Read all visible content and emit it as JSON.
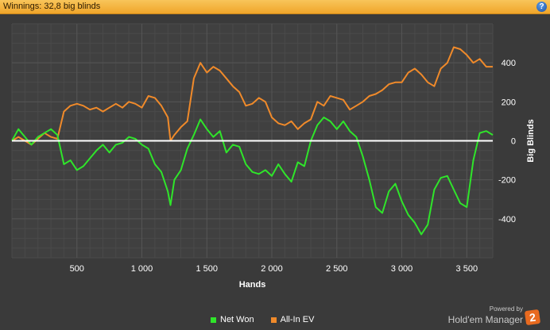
{
  "header": {
    "title": "Winnings:  32,8 big blinds",
    "help_icon": "?"
  },
  "colors": {
    "net_won": "#2fe52a",
    "all_in_ev": "#f08a2a",
    "zero_line": "#ffffff",
    "plot_bg": "#404040",
    "grid": "#555555"
  },
  "chart_data": {
    "type": "line",
    "xlabel": "Hands",
    "ylabel": "Big Blinds",
    "xlim": [
      0,
      3700
    ],
    "ylim": [
      -600,
      600
    ],
    "x_ticks": [
      500,
      1000,
      1500,
      2000,
      2500,
      3000,
      3500
    ],
    "x_tick_labels": [
      "500",
      "1 000",
      "1 500",
      "2 000",
      "2 500",
      "3 000",
      "3 500"
    ],
    "y_ticks": [
      400,
      200,
      0,
      -200,
      -400
    ],
    "y_tick_labels": [
      "400",
      "200",
      "0",
      "-200",
      "-400"
    ],
    "grid": true,
    "y_axis_position": "right",
    "series": [
      {
        "name": "Net Won",
        "x": [
          0,
          50,
          100,
          150,
          200,
          250,
          300,
          350,
          400,
          450,
          500,
          550,
          600,
          650,
          700,
          750,
          800,
          850,
          900,
          950,
          1000,
          1050,
          1100,
          1150,
          1200,
          1220,
          1250,
          1300,
          1350,
          1400,
          1450,
          1500,
          1550,
          1600,
          1650,
          1700,
          1750,
          1800,
          1850,
          1900,
          1950,
          2000,
          2050,
          2100,
          2150,
          2200,
          2250,
          2300,
          2350,
          2400,
          2450,
          2500,
          2550,
          2600,
          2650,
          2700,
          2750,
          2800,
          2850,
          2900,
          2950,
          3000,
          3050,
          3100,
          3150,
          3200,
          3250,
          3300,
          3350,
          3400,
          3450,
          3500,
          3550,
          3600,
          3650,
          3700
        ],
        "values": [
          0,
          60,
          20,
          -20,
          20,
          40,
          60,
          30,
          -120,
          -100,
          -150,
          -130,
          -90,
          -50,
          -20,
          -60,
          -20,
          -10,
          20,
          10,
          -20,
          -40,
          -120,
          -160,
          -260,
          -330,
          -200,
          -150,
          -40,
          30,
          110,
          60,
          20,
          50,
          -60,
          -20,
          -30,
          -120,
          -160,
          -170,
          -150,
          -180,
          -120,
          -170,
          -210,
          -110,
          -130,
          0,
          80,
          120,
          100,
          60,
          100,
          50,
          20,
          -80,
          -200,
          -340,
          -370,
          -260,
          -220,
          -310,
          -380,
          -420,
          -480,
          -430,
          -250,
          -190,
          -180,
          -250,
          -320,
          -340,
          -100,
          40,
          50,
          30
        ]
      },
      {
        "name": "All-In EV",
        "x": [
          0,
          50,
          100,
          150,
          200,
          250,
          300,
          350,
          400,
          450,
          500,
          550,
          600,
          650,
          700,
          750,
          800,
          850,
          900,
          950,
          1000,
          1050,
          1100,
          1150,
          1200,
          1220,
          1250,
          1300,
          1350,
          1400,
          1450,
          1500,
          1550,
          1600,
          1650,
          1700,
          1750,
          1800,
          1850,
          1900,
          1950,
          2000,
          2050,
          2100,
          2150,
          2200,
          2250,
          2300,
          2350,
          2400,
          2450,
          2500,
          2550,
          2600,
          2650,
          2700,
          2750,
          2800,
          2850,
          2900,
          2950,
          3000,
          3050,
          3100,
          3150,
          3200,
          3250,
          3300,
          3350,
          3400,
          3450,
          3500,
          3550,
          3600,
          3650,
          3700
        ],
        "values": [
          0,
          20,
          0,
          -20,
          10,
          40,
          20,
          10,
          150,
          180,
          190,
          180,
          160,
          170,
          150,
          170,
          190,
          170,
          200,
          190,
          170,
          230,
          220,
          180,
          120,
          0,
          30,
          70,
          100,
          320,
          400,
          350,
          380,
          360,
          320,
          280,
          250,
          180,
          190,
          220,
          200,
          120,
          90,
          80,
          100,
          60,
          90,
          110,
          200,
          180,
          230,
          220,
          210,
          160,
          180,
          200,
          230,
          240,
          260,
          290,
          300,
          300,
          350,
          370,
          340,
          300,
          280,
          370,
          400,
          480,
          470,
          440,
          400,
          420,
          380,
          380
        ]
      }
    ]
  },
  "legend": {
    "items": [
      "Net Won",
      "All-In EV"
    ]
  },
  "brand": {
    "powered": "Powered by",
    "name": "Hold'em Manager",
    "badge": "2"
  }
}
